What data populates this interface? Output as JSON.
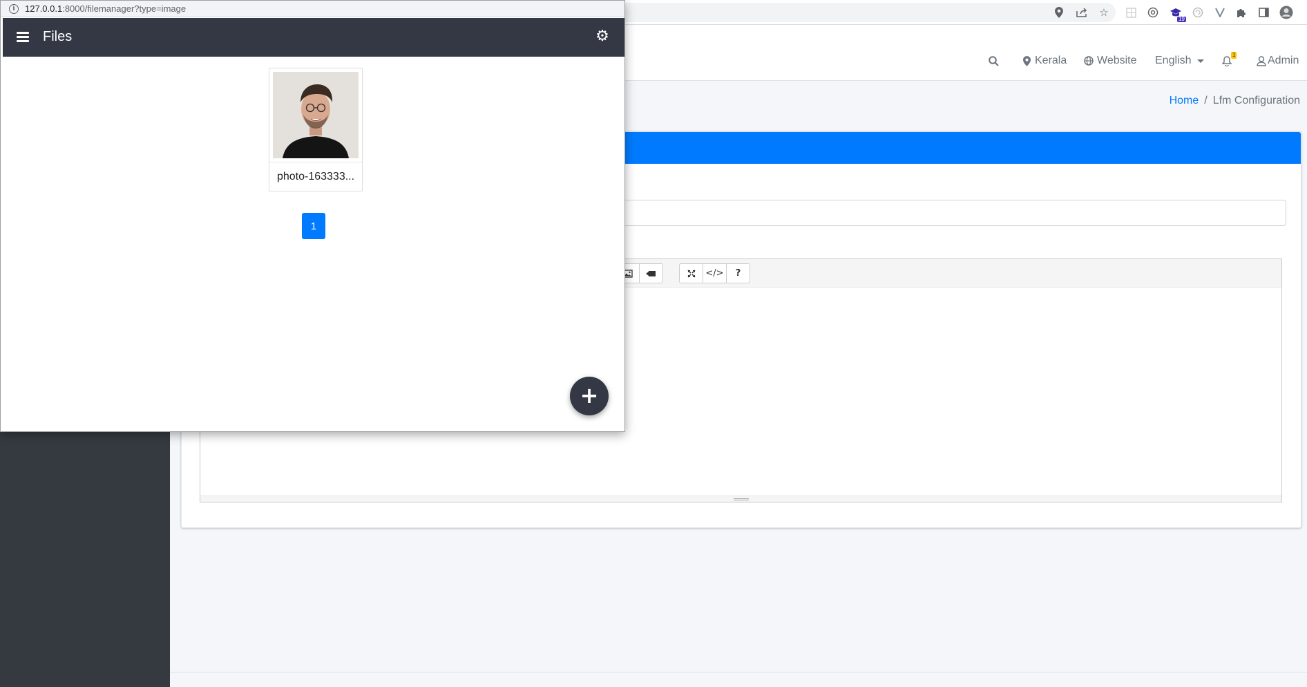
{
  "popup": {
    "url_host": "127.0.0.1",
    "url_rest": ":8000/filemanager?type=image",
    "title": "Files",
    "file": {
      "name": "photo-163333..."
    },
    "page": "1",
    "fab_label": "+"
  },
  "app": {
    "nav": {
      "location": "Kerala",
      "website": "Website",
      "language": "English",
      "notifications_count": "1",
      "user": "Admin"
    },
    "breadcrumb": {
      "home": "Home",
      "separator": "/",
      "current": "Lfm Configuration"
    },
    "accent_color": "#007bff",
    "sidebar_color": "#343a40",
    "editor_toolbar": [
      "picture-icon",
      "video-icon",
      "fullscreen-icon",
      "code-view-icon",
      "help-icon"
    ],
    "editor_toolbar_labels": {
      "code": "</>",
      "help": "?"
    }
  },
  "browser": {
    "extensions": [
      "location-pin-icon",
      "share-icon",
      "bookmark-star-icon",
      "extension-grid-icon",
      "extension-circle-icon",
      "extension-hat-icon",
      "extension-swirl-icon",
      "extension-v-icon",
      "puzzle-icon",
      "side-panel-icon",
      "profile-avatar-icon"
    ],
    "extension_badge": "19"
  }
}
